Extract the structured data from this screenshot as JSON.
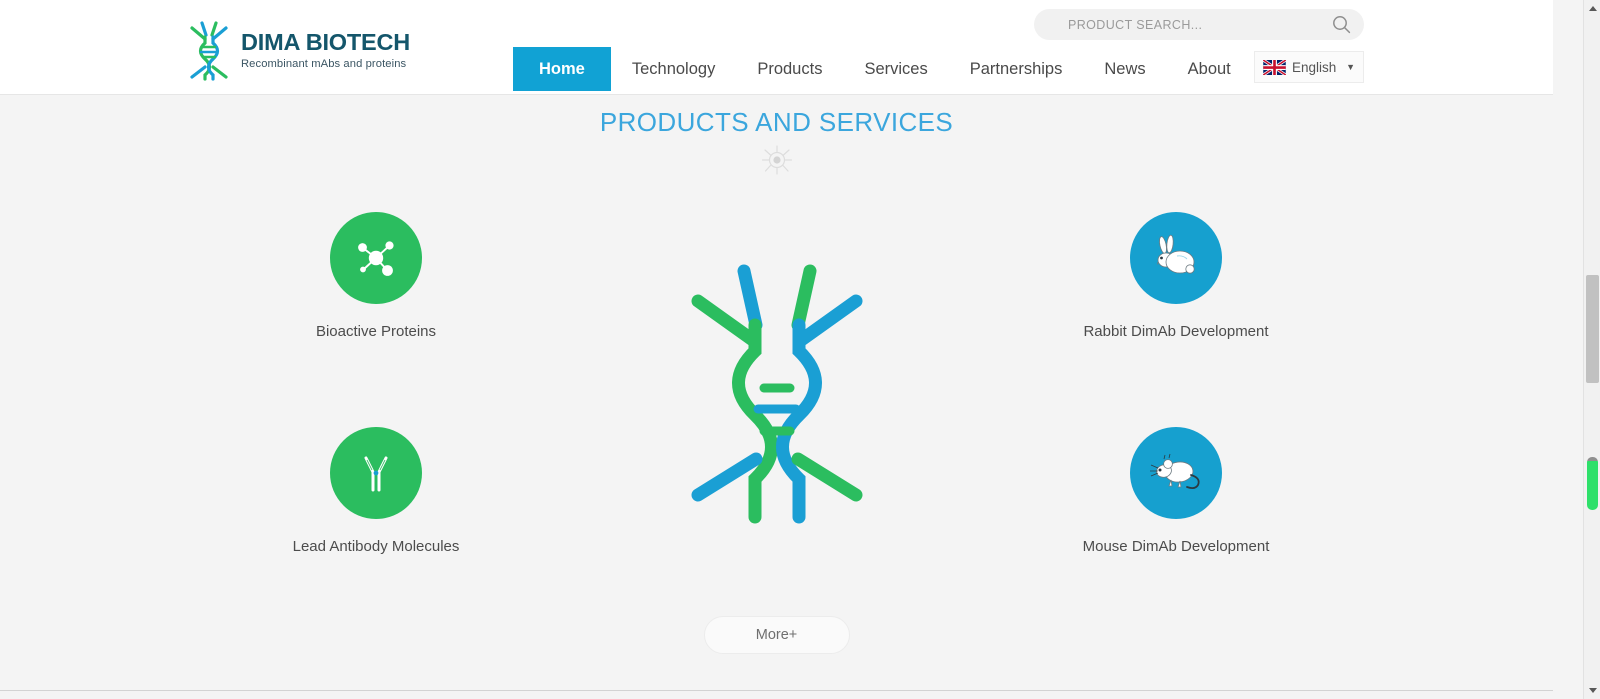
{
  "header": {
    "logo": {
      "mark": "dna-helix-icon",
      "title": "DIMA BIOTECH",
      "tagline": "Recombinant mAbs and proteins"
    },
    "nav": [
      {
        "label": "Home",
        "active": true
      },
      {
        "label": "Technology",
        "active": false
      },
      {
        "label": "Products",
        "active": false
      },
      {
        "label": "Services",
        "active": false
      },
      {
        "label": "Partnerships",
        "active": false
      },
      {
        "label": "News",
        "active": false
      },
      {
        "label": "About",
        "active": false
      }
    ],
    "search": {
      "placeholder": "PRODUCT SEARCH...",
      "value": "",
      "icon": "search-icon"
    },
    "language": {
      "label": "English",
      "flag": "uk-flag-icon",
      "caret": "▼"
    }
  },
  "main": {
    "section_title": "PRODUCTS AND SERVICES",
    "ornament_icon": "virus-cell-icon",
    "center_graphic": "dna-double-helix-graphic",
    "features": [
      {
        "label": "Bioactive Proteins",
        "icon": "molecule-icon",
        "color": "#2bbd5f",
        "position": "top-left"
      },
      {
        "label": "Lead Antibody Molecules",
        "icon": "antibody-icon",
        "color": "#2bbd5f",
        "position": "bottom-left"
      },
      {
        "label": "Rabbit DimAb Development",
        "icon": "rabbit-icon",
        "color": "#16a0cf",
        "position": "top-right"
      },
      {
        "label": "Mouse DimAb Development",
        "icon": "mouse-icon",
        "color": "#16a0cf",
        "position": "bottom-right"
      }
    ],
    "more_button": "More+"
  },
  "colors": {
    "accent_blue": "#11a2d4",
    "title_blue": "#3ba6dd",
    "green": "#2bbd5f",
    "blue": "#16a0cf",
    "logo_teal": "#14566b",
    "page_background": "#f4f4f4"
  },
  "scrollbar": {
    "up_arrow": "chevron-up-icon",
    "down_arrow": "chevron-down-icon"
  }
}
